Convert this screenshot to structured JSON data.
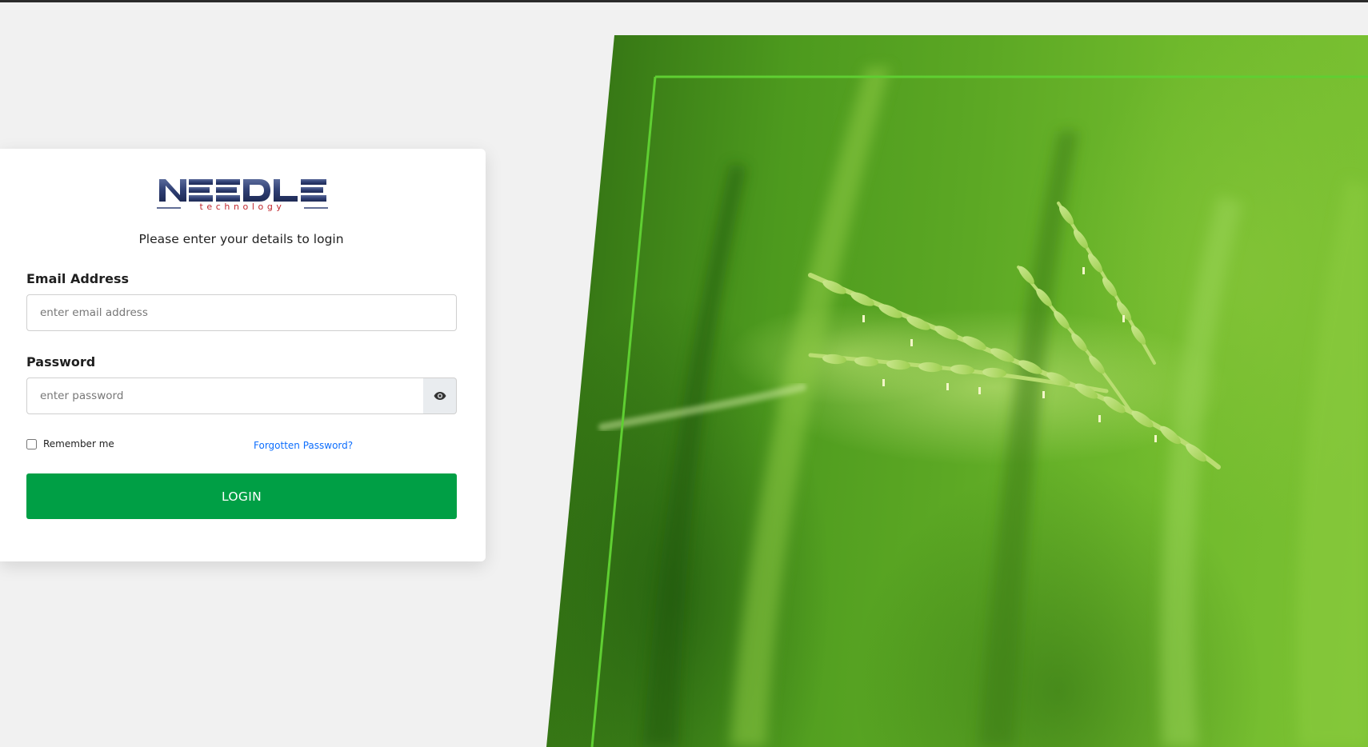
{
  "brand": {
    "logo_name": "NEEDLE",
    "logo_tagline": "technology",
    "logo_color": "#2f3f73",
    "tagline_color": "#c0262d"
  },
  "login": {
    "subtitle": "Please enter your details to login",
    "email_label": "Email Address",
    "email_placeholder": "enter email address",
    "email_value": "",
    "password_label": "Password",
    "password_placeholder": "enter password",
    "password_value": "",
    "show_password_icon": "eye-icon",
    "remember_label": "Remember me",
    "remember_checked": false,
    "forgot_label": "Forgotten Password?",
    "submit_label": "LOGIN"
  },
  "colors": {
    "primary_button": "#009f45",
    "link": "#0d6efd",
    "page_background": "#f1f1f1",
    "hero_frame_line": "#5fcf32"
  },
  "hero": {
    "image": "green rice stalks photo"
  }
}
